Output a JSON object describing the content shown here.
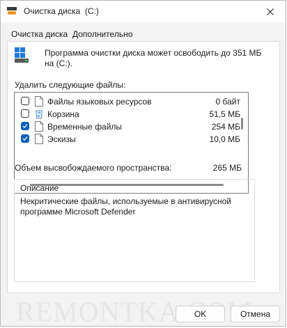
{
  "window": {
    "title": "Очистка диска  (C:)",
    "title_icon": "disk-cleanup-icon",
    "close_icon": "close-icon"
  },
  "tabs": [
    {
      "label": "Очистка диска",
      "active": true
    },
    {
      "label": "Дополнительно",
      "active": false
    }
  ],
  "info": {
    "icon": "drive-icon",
    "text": "Программа очистки диска может освободить до 351 МБ на  (C:)."
  },
  "files_section": {
    "label": "Удалить следующие файлы:",
    "items": [
      {
        "label": "Файлы языковых ресурсов",
        "size": "0 байт",
        "checked": false,
        "icon": "file-icon"
      },
      {
        "label": "Корзина",
        "size": "51,5 МБ",
        "checked": false,
        "icon": "recycle-bin-icon"
      },
      {
        "label": "Временные файлы",
        "size": "254 МБ",
        "checked": true,
        "icon": "file-icon"
      },
      {
        "label": "Эскизы",
        "size": "10,0 МБ",
        "checked": true,
        "icon": "file-icon"
      }
    ]
  },
  "total": {
    "label": "Объем высвобождаемого пространства:",
    "value": "265 МБ"
  },
  "description": {
    "title": "Описание",
    "text": "Некритические файлы, используемые в антивирусной программе Microsoft Defender"
  },
  "watermark": "REMONTKA.COM",
  "buttons": {
    "ok": "OK",
    "cancel": "Отмена"
  },
  "colors": {
    "accent": "#005fb8",
    "window_bg": "#f3f3f3"
  }
}
